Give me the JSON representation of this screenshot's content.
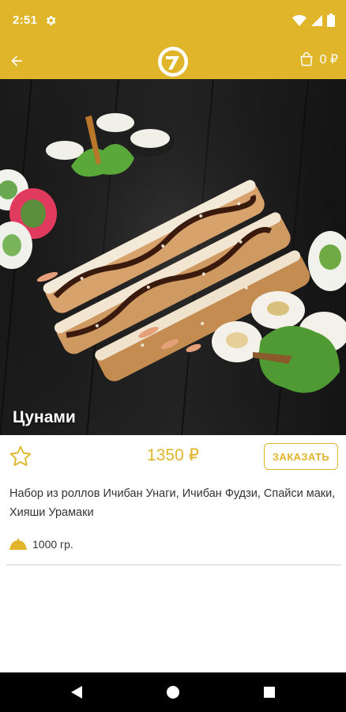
{
  "status_bar": {
    "time": "2:51",
    "icons": [
      "settings-icon",
      "wifi-icon",
      "signal-icon",
      "battery-icon"
    ]
  },
  "app_bar": {
    "back_icon": "arrow-left-icon",
    "logo_icon": "brand-logo",
    "cart_icon": "shopping-bag-icon",
    "cart_count": "0 ₽"
  },
  "product": {
    "name": "Цунами",
    "price": "1350 ₽",
    "order_label": "ЗАКАЗАТЬ",
    "description": "Набор из роллов Ичибан Унаги, Ичибан Фудзи, Спайси маки, Хияши Урамаки",
    "weight": "1000 гр.",
    "favorite_icon": "star-outline-icon",
    "weight_icon": "cloche-icon"
  },
  "colors": {
    "accent": "#e1b52a",
    "text": "#333333",
    "divider": "#e6e6e6"
  },
  "nav_bar": {
    "icons": [
      "back-triangle-icon",
      "home-circle-icon",
      "recents-square-icon"
    ]
  }
}
